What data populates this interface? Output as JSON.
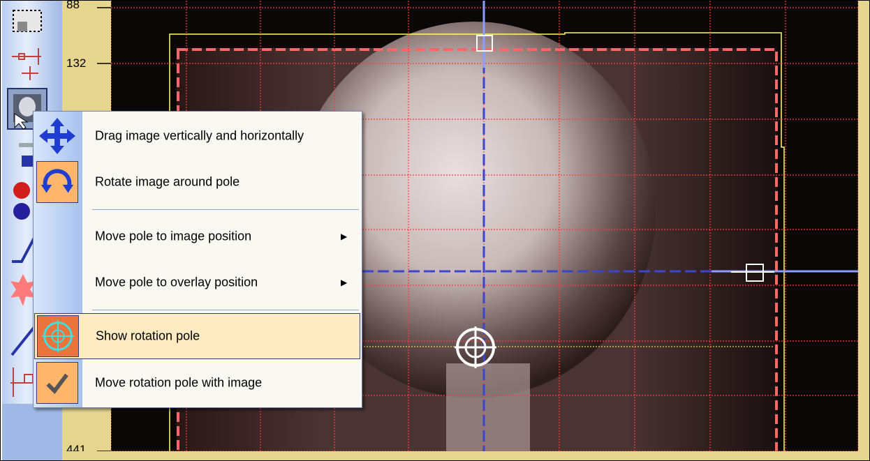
{
  "ruler": {
    "labels": [
      "88",
      "132",
      "441"
    ]
  },
  "context_menu": {
    "items": [
      {
        "label": "Drag image vertically and horizontally",
        "icon": "move-arrows-icon"
      },
      {
        "label": "Rotate image around pole",
        "icon": "rotate-icon"
      },
      {
        "label": "Move pole to image position",
        "icon": "",
        "submenu": true
      },
      {
        "label": "Move pole to overlay position",
        "icon": "",
        "submenu": true
      },
      {
        "label": "Show rotation pole",
        "icon": "crosshair-target-icon",
        "highlighted": true
      },
      {
        "label": "Move rotation pole with image",
        "icon": "checkmark-icon",
        "checked": true
      }
    ],
    "submenu_arrow": "▶"
  },
  "colors": {
    "grid_line": "#ff3b3b",
    "axis_line": "#3b46c8",
    "overlay_outline": "#ffff66",
    "menu_highlight": "#ffebc1",
    "ruler_background": "#e6d58f"
  }
}
